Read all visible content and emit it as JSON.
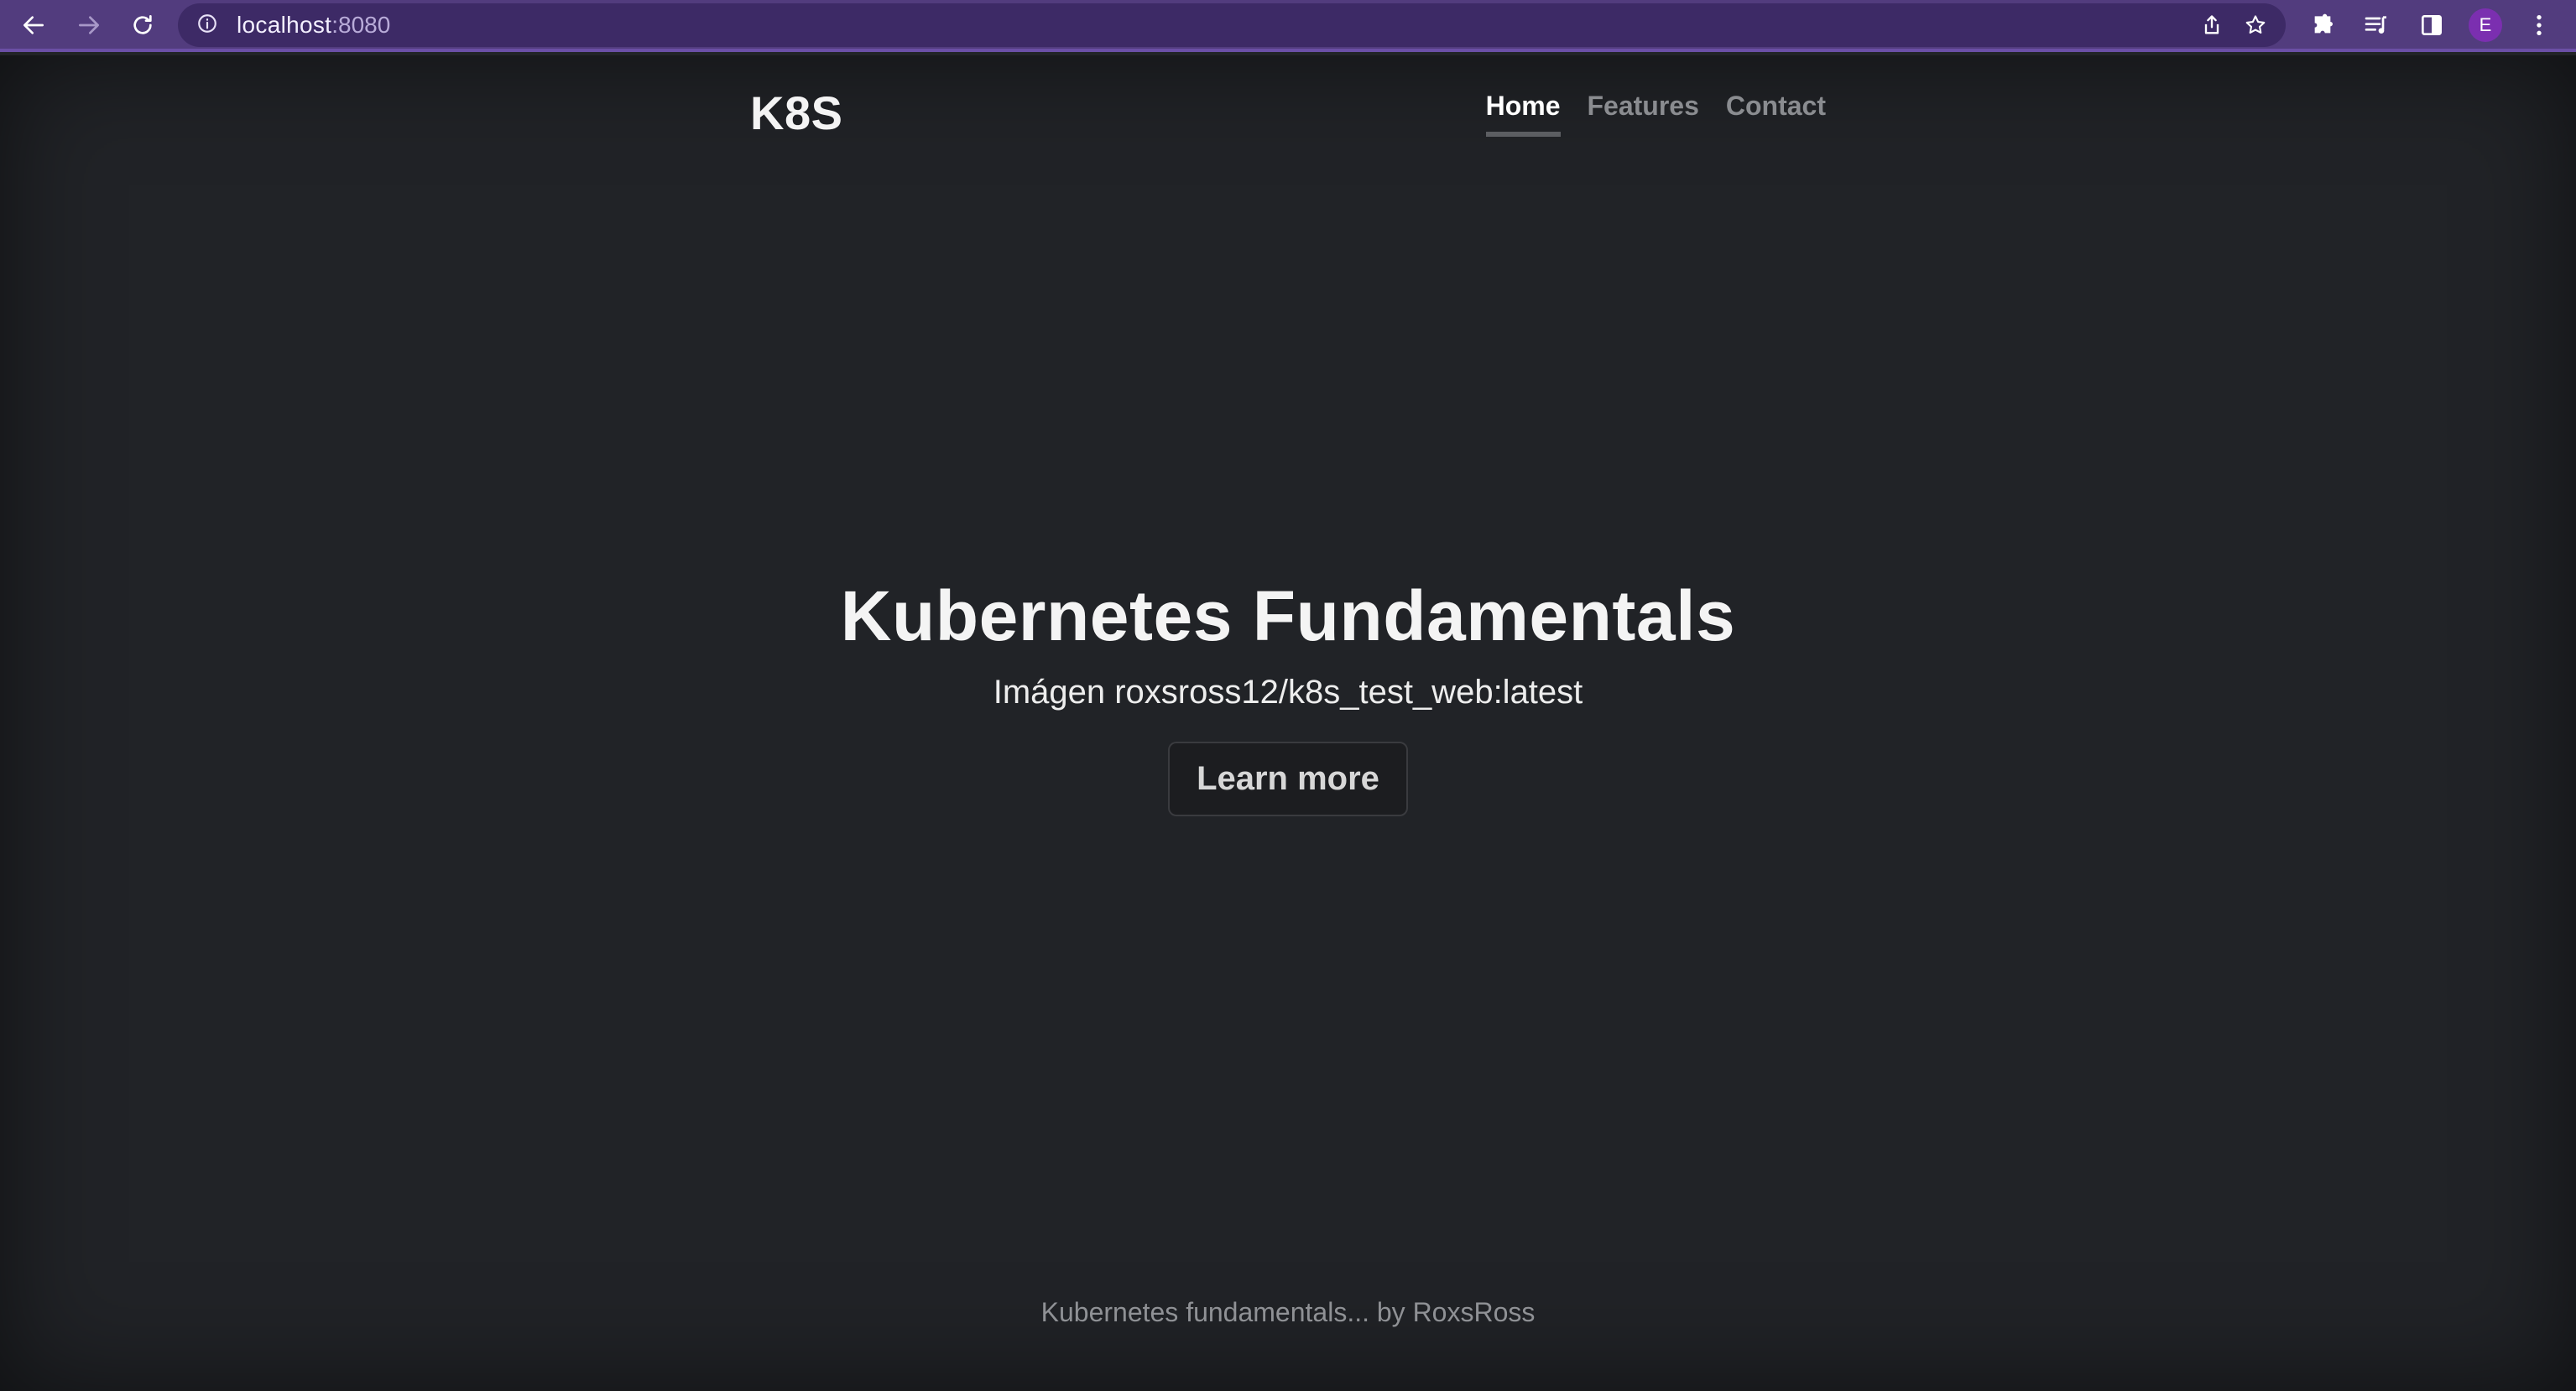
{
  "browser": {
    "url_host": "localhost",
    "url_port": ":8080",
    "profile_initial": "E",
    "icons": {
      "back": "back-arrow-icon",
      "forward": "forward-arrow-icon",
      "reload": "reload-icon",
      "site_info": "info-icon",
      "share": "share-icon",
      "bookmark": "star-icon",
      "extensions": "puzzle-icon",
      "reading_list": "reading-list-icon",
      "side_panel": "side-panel-icon",
      "menu": "kebab-menu-icon"
    },
    "colors": {
      "frame": "#523c7e",
      "address_bar": "#3d2a66",
      "avatar": "#7b2fb0"
    }
  },
  "site": {
    "brand": "K8S",
    "nav": [
      {
        "label": "Home",
        "active": true
      },
      {
        "label": "Features",
        "active": false
      },
      {
        "label": "Contact",
        "active": false
      }
    ],
    "hero": {
      "title": "Kubernetes Fundamentals",
      "subtitle": "Imágen roxsross12/k8s_test_web:latest",
      "button_label": "Learn more"
    },
    "footer": "Kubernetes fundamentals... by RoxsRoss",
    "colors": {
      "background": "#212327",
      "text": "#f4f4f4",
      "muted": "#8a8c90"
    }
  }
}
